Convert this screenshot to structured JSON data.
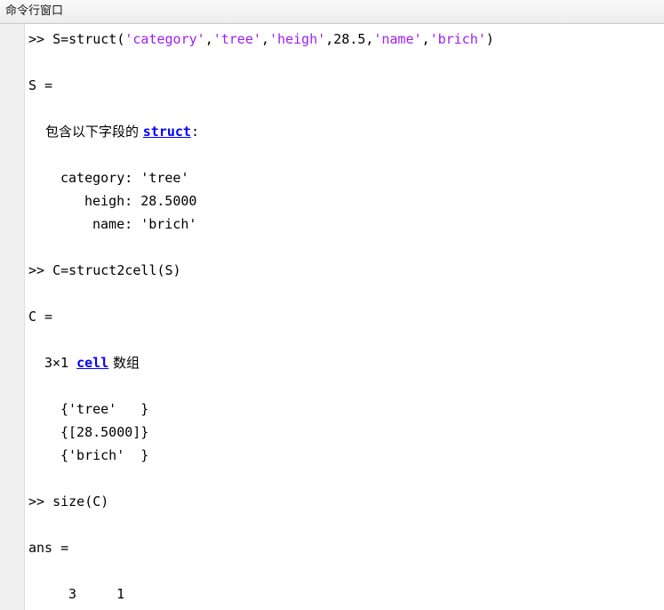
{
  "window": {
    "title": "命令行窗口"
  },
  "console": {
    "cmd1": {
      "prompt": ">>",
      "pre": " S=struct(",
      "s1": "'category'",
      "c1": ",",
      "s2": "'tree'",
      "c2": ",",
      "s3": "'heigh'",
      "c3": ",28.5,",
      "s4": "'name'",
      "c4": ",",
      "s5": "'brich'",
      "post": ")"
    },
    "out1_var": "S =",
    "out1_desc_prefix": "包含以下字段的 ",
    "out1_desc_link": "struct",
    "out1_desc_suffix": ":",
    "fields": [
      {
        "name": "category:",
        "value": " 'tree'"
      },
      {
        "name": "heigh:",
        "value": " 28.5000"
      },
      {
        "name": "name:",
        "value": " 'brich'"
      }
    ],
    "cmd2": {
      "prompt": ">>",
      "text": " C=struct2cell(S)"
    },
    "out2_var": "C =",
    "out2_size": "3×1 ",
    "out2_link": "cell",
    "out2_suffix": " 数组",
    "cells": [
      "{'tree'   }",
      "{[28.5000]}",
      "{'brich'  }"
    ],
    "cmd3": {
      "prompt": ">>",
      "text": " size(C)"
    },
    "out3_var": "ans =",
    "out3_values": "3     1"
  }
}
